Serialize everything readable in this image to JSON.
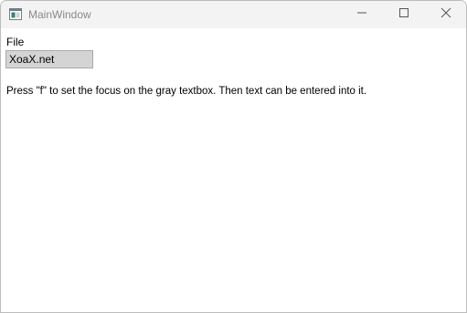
{
  "window": {
    "title": "MainWindow"
  },
  "titlebar": {
    "icons": {
      "app": "app-window-icon",
      "minimize": "minimize-icon",
      "maximize": "maximize-icon",
      "close": "close-icon"
    }
  },
  "menu": {
    "file_label": "File"
  },
  "textbox": {
    "value": "XoaX.net",
    "background_color": "#d4d4d4"
  },
  "instruction": {
    "text": "Press \"f\" to set the focus on the gray textbox. Then text can be entered into it."
  }
}
